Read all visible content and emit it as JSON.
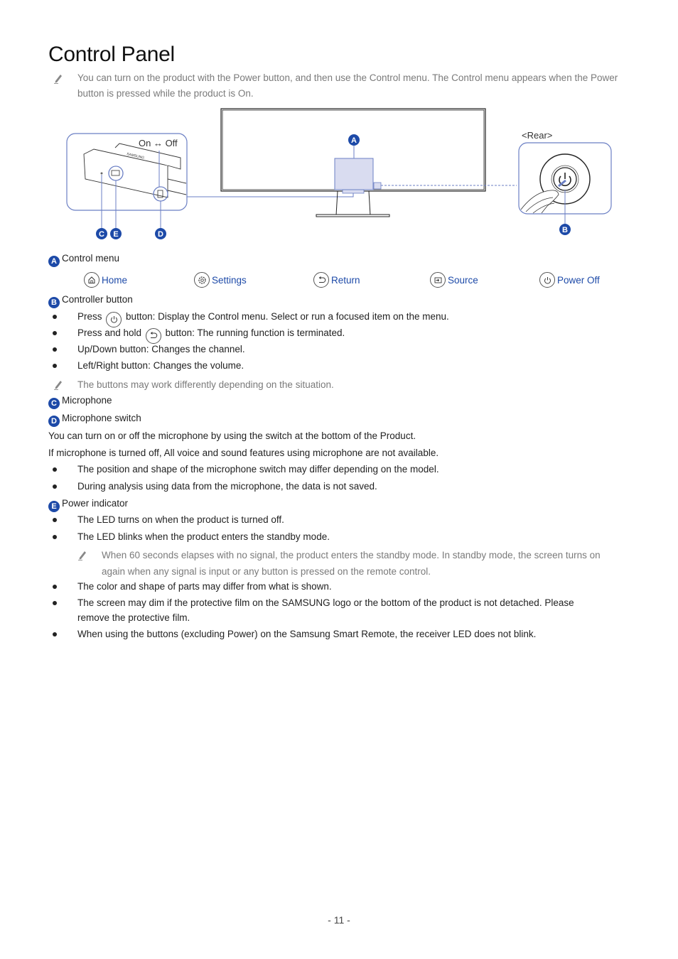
{
  "page": {
    "title": "Control Panel",
    "page_number": "- 11 -"
  },
  "intro_note": "You can turn on the product with the Power button, and then use the Control menu. The Control menu appears when the Power button is pressed while the product is On.",
  "diagram": {
    "switch_label": "On ↔ Off",
    "rear_label": "<Rear>",
    "logo_text": "SAMSUNG",
    "callouts": [
      "A",
      "B",
      "C",
      "E",
      "D"
    ],
    "accent_color": "#1d4aa8",
    "highlight_color": "#d9dcf0"
  },
  "sections": {
    "a": {
      "badge": "A",
      "label": "Control menu",
      "menu_items": [
        {
          "icon": "home-icon",
          "label": "Home"
        },
        {
          "icon": "settings-icon",
          "label": "Settings"
        },
        {
          "icon": "return-icon",
          "label": "Return"
        },
        {
          "icon": "source-icon",
          "label": "Source"
        },
        {
          "icon": "power-icon",
          "label": "Power Off"
        }
      ]
    },
    "b": {
      "badge": "B",
      "label": "Controller button",
      "bullets": [
        {
          "pre": "Press",
          "icon": "power-icon",
          "post": "button: Display the Control menu. Select or run a focused item on the menu."
        },
        {
          "pre": "Press and hold",
          "icon": "return-icon",
          "post": "button: The running function is terminated."
        },
        {
          "text": "Up/Down button: Changes the channel."
        },
        {
          "text": "Left/Right button: Changes the volume."
        }
      ],
      "note": "The buttons may work differently depending on the situation."
    },
    "c": {
      "badge": "C",
      "label": "Microphone"
    },
    "d": {
      "badge": "D",
      "label": "Microphone switch",
      "paragraphs": [
        "You can turn on or off the microphone by using the switch at the bottom of the Product.",
        "If microphone is turned off, All voice and sound features using microphone are not available."
      ],
      "bullets": [
        "The position and shape of the microphone switch may differ depending on the model.",
        "During analysis using data from the microphone, the data is not saved."
      ]
    },
    "e": {
      "badge": "E",
      "label": "Power indicator",
      "bullets": [
        "The LED turns on when the product is turned off.",
        "The LED blinks when the product enters the standby mode."
      ],
      "note_line1": "When 60 seconds elapses with no signal, the product enters the standby mode. In standby mode, the screen turns on",
      "note_line2": "again when any signal is input or any button is pressed on the remote control."
    },
    "general_bullets": [
      "The color and shape of parts may differ from what is shown.",
      "The screen may dim if the protective film on the SAMSUNG logo or the bottom of the product is not detached. Please",
      "remove the protective film.",
      "When using the buttons (excluding Power) on the Samsung Smart Remote, the receiver LED does not blink."
    ]
  }
}
